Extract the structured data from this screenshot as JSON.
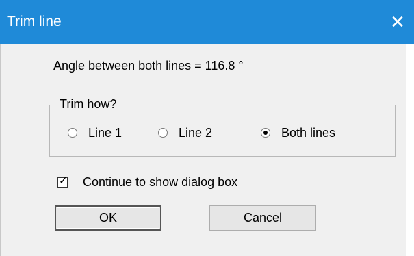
{
  "window": {
    "title": "Trim line",
    "close_glyph": "✕"
  },
  "info": {
    "angle_text": "Angle between both lines = 116.8 °"
  },
  "trim_group": {
    "legend": "Trim how?",
    "options": [
      {
        "label": "Line 1",
        "checked": false
      },
      {
        "label": "Line 2",
        "checked": false
      },
      {
        "label": "Both lines",
        "checked": true
      }
    ]
  },
  "continue_checkbox": {
    "label": "Continue to show dialog box",
    "checked": true,
    "check_glyph": "✓"
  },
  "buttons": {
    "ok_label": "OK",
    "cancel_label": "Cancel"
  },
  "colors": {
    "titlebar": "#1f8ad8",
    "dialog_bg": "#f0f0f0"
  }
}
